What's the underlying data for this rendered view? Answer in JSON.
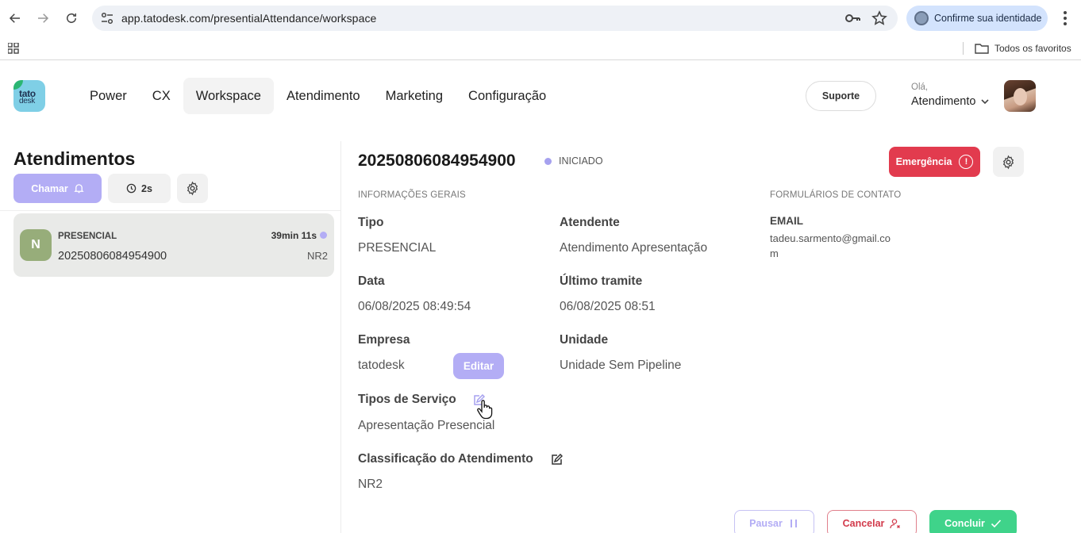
{
  "browser": {
    "url": "app.tatodesk.com/presentialAttendance/workspace",
    "identity_label": "Confirme sua identidade",
    "bookmarks_label": "Todos os favoritos"
  },
  "header": {
    "logo_line1": "tato",
    "logo_line2": "desk",
    "nav": [
      {
        "label": "Power"
      },
      {
        "label": "CX"
      },
      {
        "label": "Workspace",
        "active": true
      },
      {
        "label": "Atendimento"
      },
      {
        "label": "Marketing"
      },
      {
        "label": "Configuração"
      }
    ],
    "support_label": "Suporte",
    "greeting": "Olá,",
    "user_role": "Atendimento"
  },
  "left_panel": {
    "title": "Atendimentos",
    "call_label": "Chamar",
    "timer_label": "2s",
    "card": {
      "initial": "N",
      "type": "PRESENCIAL",
      "code": "20250806084954900",
      "elapsed": "39min 11s",
      "classification": "NR2"
    }
  },
  "detail": {
    "code": "20250806084954900",
    "status": "INICIADO",
    "emergency_label": "Emergência",
    "general_section": "INFORMAÇÕES GERAIS",
    "contact_section": "FORMULÁRIOS DE CONTATO",
    "fields": {
      "tipo_label": "Tipo",
      "tipo_value": "PRESENCIAL",
      "atendente_label": "Atendente",
      "atendente_value": "Atendimento Apresentação",
      "data_label": "Data",
      "data_value": "06/08/2025 08:49:54",
      "ultimo_label": "Último tramite",
      "ultimo_value": "06/08/2025 08:51",
      "empresa_label": "Empresa",
      "empresa_value": "tatodesk",
      "editar_label": "Editar",
      "unidade_label": "Unidade",
      "unidade_value": "Unidade Sem Pipeline",
      "servico_label": "Tipos de Serviço",
      "servico_value": "Apresentação Presencial",
      "classificacao_label": "Classificação do Atendimento",
      "classificacao_value": "NR2"
    },
    "email_label": "EMAIL",
    "email_value": "tadeu.sarmento@gmail.com"
  },
  "footer_actions": {
    "pause_label": "Pausar",
    "cancel_label": "Cancelar",
    "conclude_label": "Concluir"
  },
  "colors": {
    "accent": "#b3adf5",
    "emergency": "#e23b4e",
    "success": "#3fd38a",
    "avatar_card": "#97ad7a"
  }
}
